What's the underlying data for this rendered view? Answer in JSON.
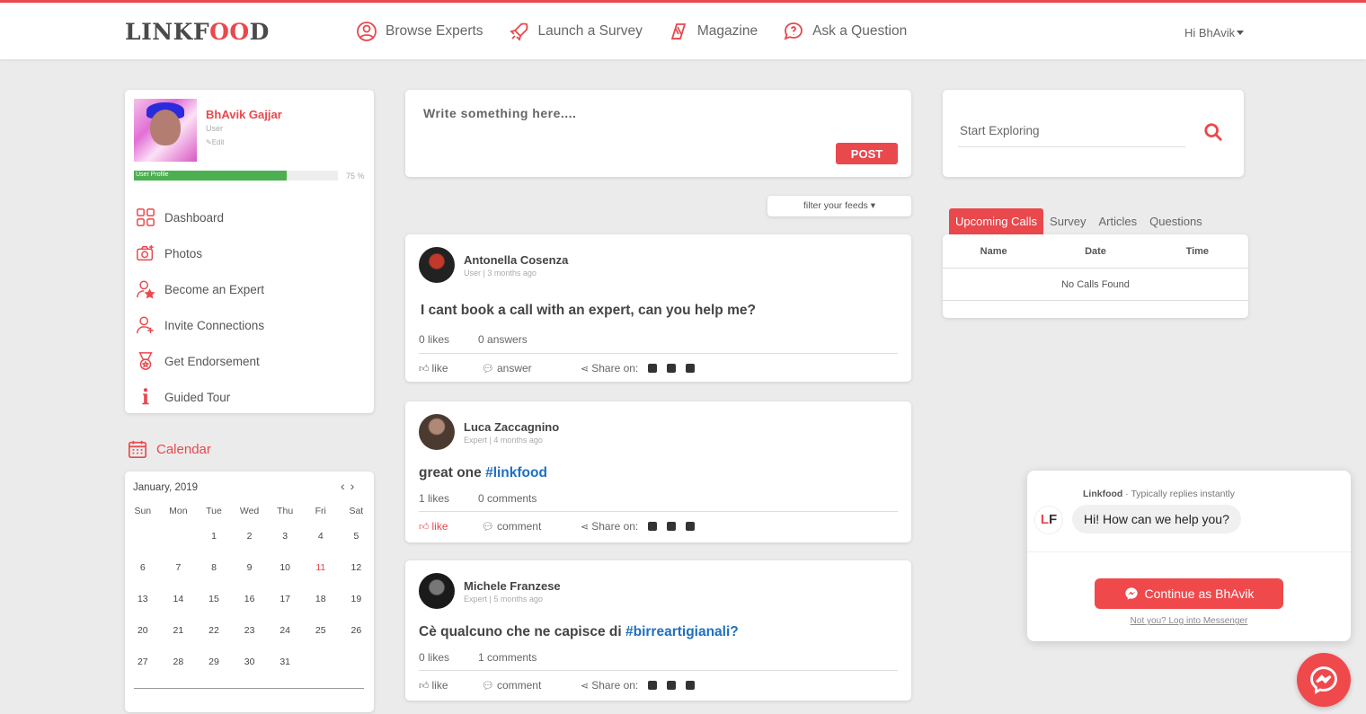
{
  "brand": {
    "logo_prefix": "LINKF",
    "logo_mid": "OO",
    "logo_suffix": "D"
  },
  "nav": [
    {
      "label": "Browse Experts",
      "icon": "expert-icon"
    },
    {
      "label": "Launch a Survey",
      "icon": "rocket-icon"
    },
    {
      "label": "Magazine",
      "icon": "magazine-icon"
    },
    {
      "label": "Ask a Question",
      "icon": "question-bubble-icon"
    }
  ],
  "user_menu": {
    "label": "Hi BhAvik"
  },
  "profile": {
    "name": "BhAvik Gajjar",
    "role": "User",
    "edit": "Edit",
    "progress_label": "User Profile",
    "progress_text": "75 %",
    "progress_fraction": 0.75,
    "menu": [
      {
        "label": "Dashboard",
        "icon": "dashboard-icon"
      },
      {
        "label": "Photos",
        "icon": "camera-icon"
      },
      {
        "label": "Become an Expert",
        "icon": "expert-star-icon"
      },
      {
        "label": "Invite Connections",
        "icon": "add-user-icon"
      },
      {
        "label": "Get Endorsement",
        "icon": "medal-icon"
      },
      {
        "label": "Guided Tour",
        "icon": "info-icon"
      }
    ]
  },
  "calendar": {
    "heading": "Calendar",
    "month": "January, 2019",
    "weekdays": [
      "Sun",
      "Mon",
      "Tue",
      "Wed",
      "Thu",
      "Fri",
      "Sat"
    ],
    "lead_blanks": 2,
    "days": [
      "1",
      "2",
      "3",
      "4",
      "5",
      "6",
      "7",
      "8",
      "9",
      "10",
      "11",
      "12",
      "13",
      "14",
      "15",
      "16",
      "17",
      "18",
      "19",
      "20",
      "21",
      "22",
      "23",
      "24",
      "25",
      "26",
      "27",
      "28",
      "29",
      "30",
      "31"
    ],
    "today": "11"
  },
  "composer": {
    "placeholder": "Write something here....",
    "post_label": "POST"
  },
  "filter": {
    "label": "filter your feeds"
  },
  "posts": [
    {
      "author": "Antonella Cosenza",
      "meta": "User | 3 months ago",
      "text": "I cant book a call with an expert, can you help me?",
      "tag": "",
      "likes": "0 likes",
      "replies": "0 answers",
      "like_label": "like",
      "reply_label": "answer",
      "liked": false,
      "share_label": "Share on:"
    },
    {
      "author": "Luca Zaccagnino",
      "meta": "Expert | 4 months ago",
      "text": "great one ",
      "tag": "#linkfood",
      "likes": "1 likes",
      "replies": "0 comments",
      "like_label": "like",
      "reply_label": "comment",
      "liked": true,
      "share_label": "Share on:"
    },
    {
      "author": "Michele Franzese",
      "meta": "Expert | 5 months ago",
      "text": "Cè qualcuno che ne capisce di ",
      "tag": "#birreartigianali?",
      "likes": "0 likes",
      "replies": "1 comments",
      "like_label": "like",
      "reply_label": "comment",
      "liked": false,
      "share_label": "Share on:"
    }
  ],
  "search": {
    "placeholder": "Start Exploring"
  },
  "tabs": [
    {
      "label": "Upcoming Calls",
      "active": true
    },
    {
      "label": "Survey",
      "active": false
    },
    {
      "label": "Articles",
      "active": false
    },
    {
      "label": "Questions",
      "active": false
    }
  ],
  "calls": {
    "columns": [
      "Name",
      "Date",
      "Time"
    ],
    "empty": "No Calls Found"
  },
  "chat": {
    "page_name": "Linkfood",
    "status": " · Typically replies instantly",
    "message": "Hi! How can we help you?",
    "logo_l": "L",
    "logo_f": "F",
    "button": "Continue as BhAvik",
    "link": "Not you? Log into Messenger"
  },
  "colors": {
    "accent": "#e9484c",
    "progress": "#4caf50",
    "hashtag": "#1f6fbf",
    "messenger": "#f0494c"
  }
}
